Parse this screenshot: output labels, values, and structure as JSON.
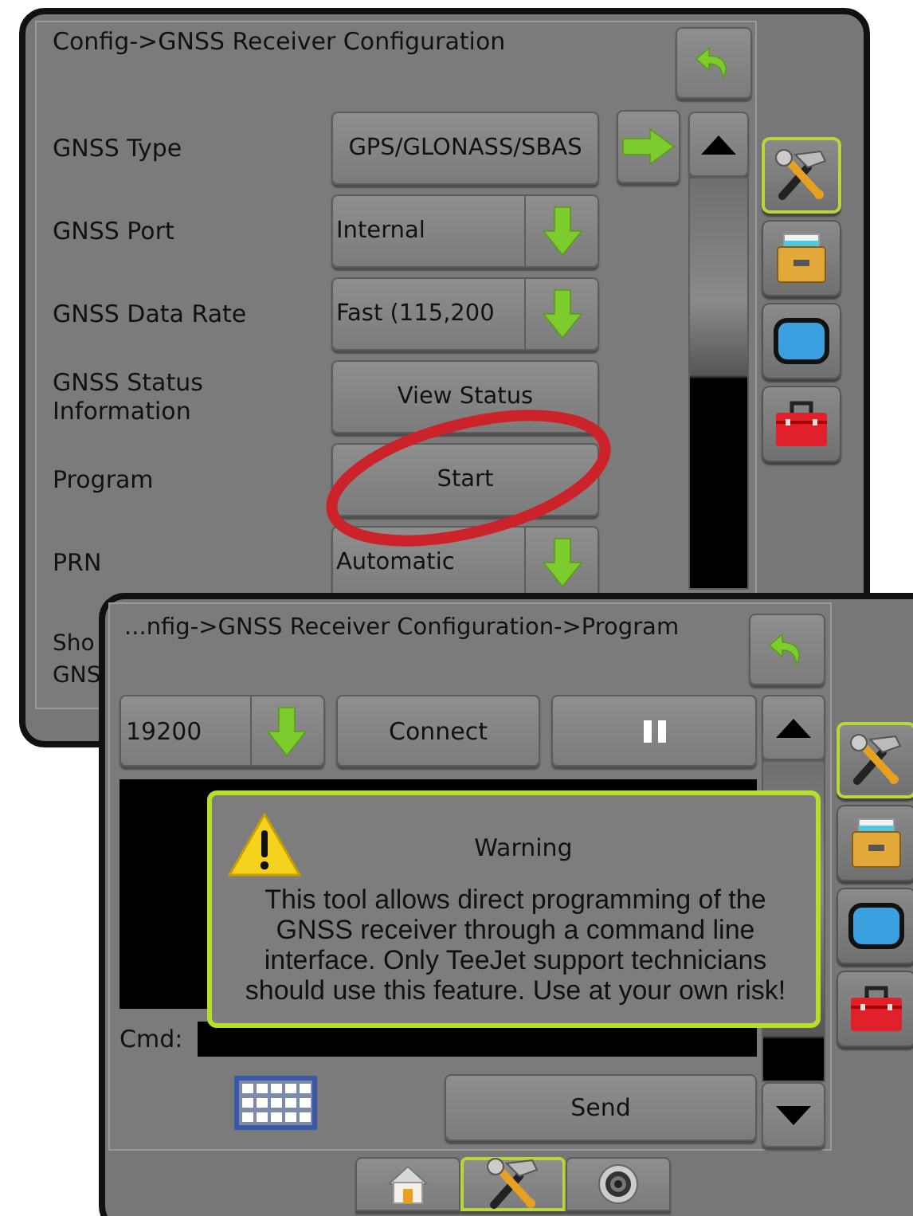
{
  "config_screen": {
    "title": "Config->GNSS Receiver Configuration",
    "settings": [
      {
        "label": "GNSS Type",
        "kind": "next",
        "value": "GPS/GLONASS/SBAS"
      },
      {
        "label": "GNSS Port",
        "kind": "dropdown",
        "value": "Internal"
      },
      {
        "label": "GNSS Data Rate",
        "kind": "dropdown",
        "value": "Fast (115,200"
      },
      {
        "label": "GNSS Status Information",
        "kind": "button",
        "value": "View Status"
      },
      {
        "label": "Program",
        "kind": "button",
        "value": "Start"
      },
      {
        "label": "PRN",
        "kind": "dropdown",
        "value": "Automatic"
      },
      {
        "label": "Sho GNS",
        "kind": "cut"
      }
    ],
    "sidebar": [
      {
        "kind": "tools",
        "selected": true
      },
      {
        "kind": "storage",
        "selected": false
      },
      {
        "kind": "display",
        "selected": false
      },
      {
        "kind": "toolbox",
        "selected": false
      }
    ]
  },
  "program_screen": {
    "title": "...nfig->GNSS Receiver Configuration->Program",
    "baud_rate": "19200",
    "connect": "Connect",
    "cmd_label": "Cmd:",
    "send": "Send",
    "warning": {
      "title": "Warning",
      "message": "This tool allows direct programming of the GNSS receiver through a command line interface. Only TeeJet support technicians should use this feature. Use at your own risk!"
    },
    "sidebar": [
      {
        "kind": "tools",
        "selected": true
      },
      {
        "kind": "storage",
        "selected": false
      },
      {
        "kind": "display",
        "selected": false
      },
      {
        "kind": "toolbox",
        "selected": false
      }
    ],
    "bottom_tabs": [
      {
        "kind": "home",
        "selected": false
      },
      {
        "kind": "tools",
        "selected": true
      },
      {
        "kind": "camera",
        "selected": false
      }
    ]
  }
}
